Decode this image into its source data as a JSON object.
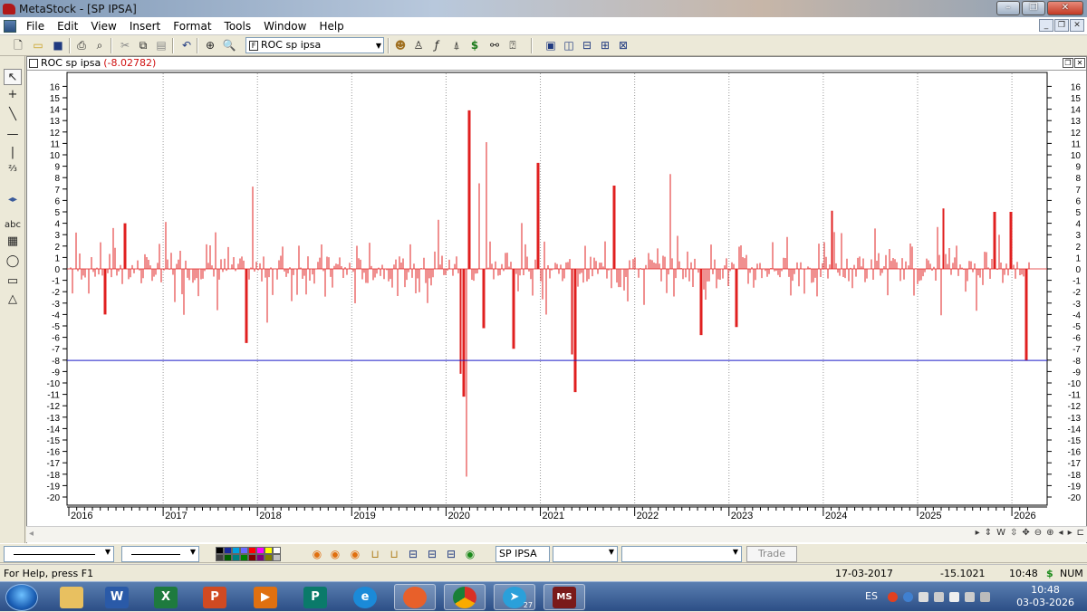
{
  "window": {
    "title": "MetaStock - [SP IPSA]",
    "controls": [
      "minimize",
      "restore",
      "close"
    ]
  },
  "menubar": {
    "items": [
      "File",
      "Edit",
      "View",
      "Insert",
      "Format",
      "Tools",
      "Window",
      "Help"
    ]
  },
  "toolbar": {
    "security_combo_value": "ROC sp ipsa",
    "icons": [
      "new-icon",
      "open-icon",
      "save-icon",
      "print-icon",
      "print-preview-icon",
      "cut-icon",
      "copy-icon",
      "paste-icon",
      "undo-icon",
      "crosshair-icon",
      "zoom-icon",
      "formula-icon",
      "expert-icon",
      "indicator-icon",
      "explorer-icon",
      "system-tester-icon",
      "dollar-icon",
      "binoculars-icon",
      "help-pointer-icon",
      "window-cascade-icon",
      "tile-vertical-icon",
      "tile-horizontal-icon",
      "tile-grid-icon",
      "options-icon"
    ]
  },
  "left_tools": [
    "pointer-icon",
    "crosshair-tool-icon",
    "trendline-icon",
    "horizontal-line-icon",
    "vertical-line-icon",
    "fibonacci-icon",
    "scroll-icon",
    "text-icon",
    "grid-tool-icon",
    "ellipse-icon",
    "rectangle-icon",
    "triangle-icon"
  ],
  "left_tools_text_label": "abc",
  "chart": {
    "pane_title": "ROC sp ipsa",
    "pane_value": "(-8.02782)",
    "series_color": "#e02020",
    "hline_color": "#1a1ac8"
  },
  "chart_data": {
    "type": "bar",
    "title": "ROC sp ipsa",
    "ylim": [
      -21,
      17
    ],
    "yticks": [
      16,
      15,
      14,
      13,
      12,
      11,
      10,
      9,
      8,
      7,
      6,
      5,
      4,
      3,
      2,
      1,
      0,
      -1,
      -2,
      -3,
      -4,
      -5,
      -6,
      -7,
      -8,
      -9,
      -10,
      -11,
      -12,
      -13,
      -14,
      -15,
      -16,
      -17,
      -18,
      -19,
      -20
    ],
    "xlabels": [
      "2016",
      "2017",
      "2018",
      "2019",
      "2020",
      "2021",
      "2022",
      "2023",
      "2024",
      "2025",
      "2026"
    ],
    "x_range": [
      2016.0,
      2026.22
    ],
    "horizontal_line": -8.03,
    "grid": "vertical dotted at year boundaries",
    "notable_bars": [
      {
        "x": 2016.38,
        "value": -4.0
      },
      {
        "x": 2016.6,
        "value": 4.0
      },
      {
        "x": 2017.88,
        "value": -6.5
      },
      {
        "x": 2017.95,
        "value": 7.2
      },
      {
        "x": 2018.1,
        "value": -4.7
      },
      {
        "x": 2019.92,
        "value": 4.3
      },
      {
        "x": 2020.15,
        "value": -9.2
      },
      {
        "x": 2020.19,
        "value": -11.2
      },
      {
        "x": 2020.22,
        "value": -18.2
      },
      {
        "x": 2020.25,
        "value": 13.9
      },
      {
        "x": 2020.35,
        "value": 7.5
      },
      {
        "x": 2020.4,
        "value": -5.2
      },
      {
        "x": 2020.43,
        "value": 11.1
      },
      {
        "x": 2020.72,
        "value": -7.0
      },
      {
        "x": 2020.98,
        "value": 9.3
      },
      {
        "x": 2021.33,
        "value": -7.5
      },
      {
        "x": 2021.37,
        "value": -10.8
      },
      {
        "x": 2021.78,
        "value": 7.3
      },
      {
        "x": 2022.38,
        "value": 8.3
      },
      {
        "x": 2022.7,
        "value": -5.8
      },
      {
        "x": 2023.08,
        "value": -5.1
      },
      {
        "x": 2024.1,
        "value": 5.1
      },
      {
        "x": 2025.28,
        "value": 5.3
      },
      {
        "x": 2025.82,
        "value": 5.0
      },
      {
        "x": 2025.99,
        "value": 5.0
      },
      {
        "x": 2026.15,
        "value": -8.03
      }
    ]
  },
  "bottombar": {
    "security_field": "SP IPSA",
    "trade_button": "Trade"
  },
  "statusbar": {
    "help": "For Help, press F1",
    "date": "17-03-2017",
    "value": "-15.1021",
    "time": "10:48",
    "currency": "$",
    "numlock": "NUM"
  },
  "taskbar": {
    "apps": [
      "explorer-icon",
      "word-icon",
      "excel-icon",
      "powerpoint-icon",
      "media-player-icon",
      "publisher-icon",
      "edge-icon",
      "firefox-icon",
      "chrome-icon",
      "telegram-icon",
      "metastock-icon"
    ],
    "telegram_badge": "27",
    "language": "ES",
    "clock_time": "10:48",
    "clock_date": "03-03-2026"
  }
}
